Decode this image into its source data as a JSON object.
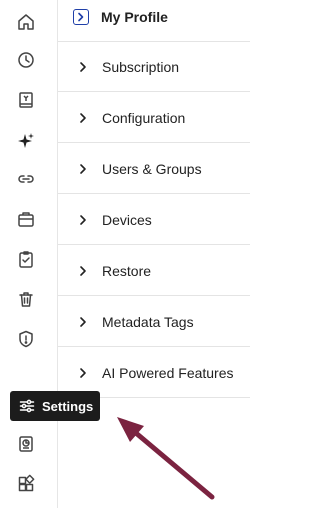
{
  "rail": {
    "icons": [
      {
        "name": "home-icon"
      },
      {
        "name": "clock-icon"
      },
      {
        "name": "book-icon"
      },
      {
        "name": "sparkle-icon"
      },
      {
        "name": "link-icon"
      },
      {
        "name": "briefcase-icon"
      },
      {
        "name": "clipboard-check-icon"
      },
      {
        "name": "trash-icon"
      },
      {
        "name": "shield-alert-icon"
      },
      {
        "name": "report-icon"
      },
      {
        "name": "apps-icon"
      }
    ]
  },
  "menu": {
    "profile_label": "My Profile",
    "items": [
      {
        "label": "Subscription"
      },
      {
        "label": "Configuration"
      },
      {
        "label": "Users & Groups"
      },
      {
        "label": "Devices"
      },
      {
        "label": "Restore"
      },
      {
        "label": "Metadata Tags"
      },
      {
        "label": "AI Powered Features"
      }
    ]
  },
  "tooltip": {
    "label": "Settings",
    "icon": "sliders-icon"
  },
  "colors": {
    "accent": "#1f3fa8",
    "tooltip_bg": "#1c1c1c",
    "arrow": "#7b2340",
    "icon_stroke": "#444444"
  }
}
